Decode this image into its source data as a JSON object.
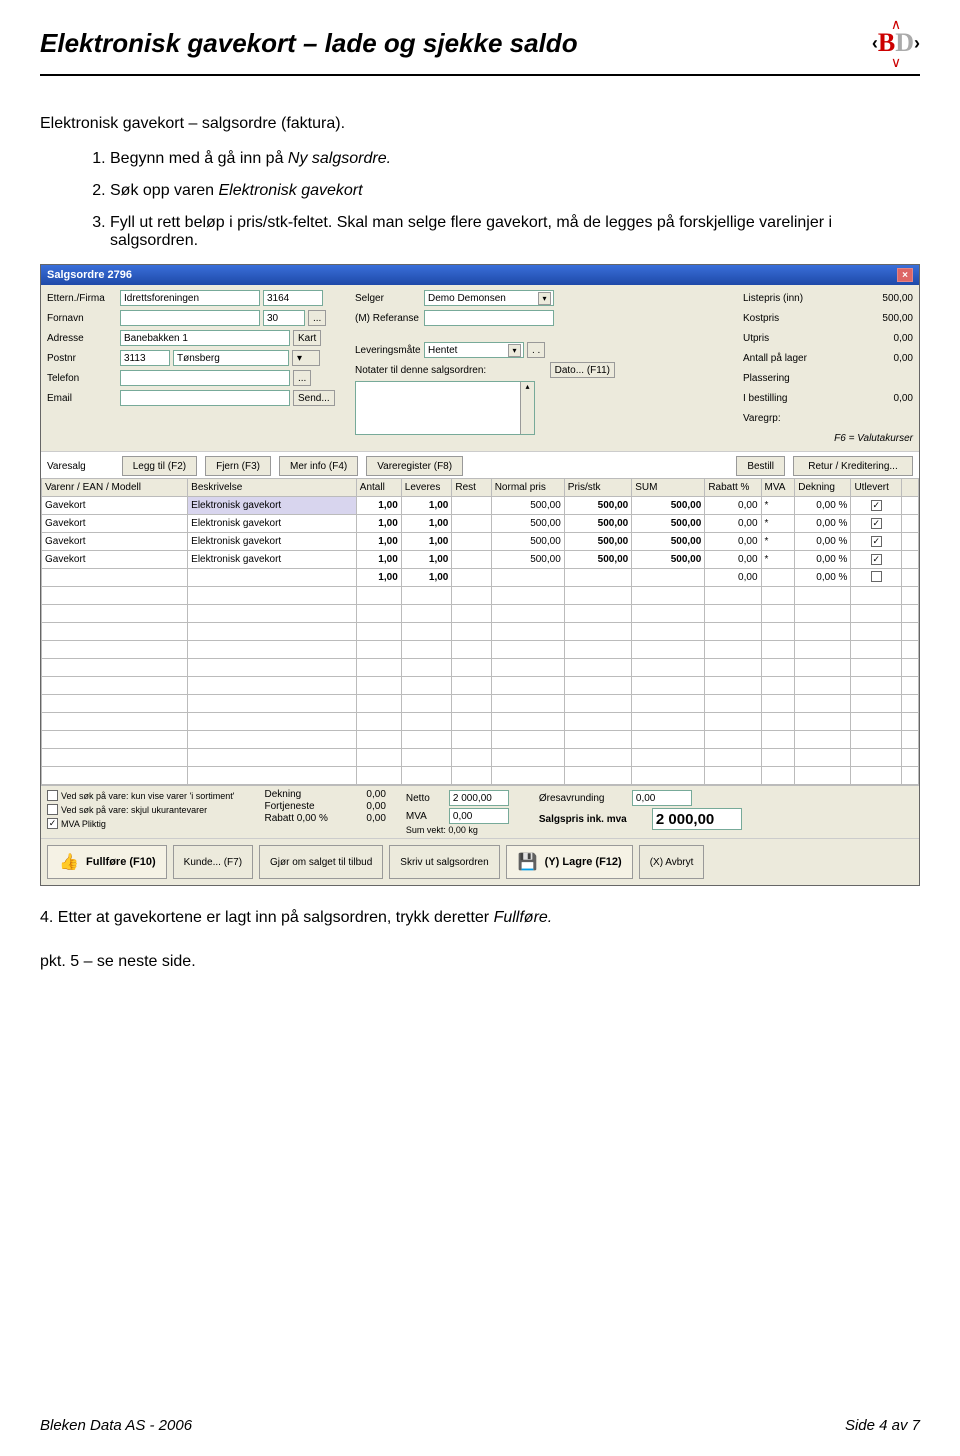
{
  "doc": {
    "title": "Elektronisk gavekort – lade og sjekke saldo",
    "section_heading": "Elektronisk gavekort – salgsordre (faktura).",
    "step1_a": "Begynn med å gå inn på ",
    "step1_em": "Ny salgsordre.",
    "step2_a": "Søk opp varen ",
    "step2_em": "Elektronisk gavekort",
    "step3": "Fyll ut rett beløp i pris/stk-feltet. Skal man selge flere gavekort, må de legges på forskjellige varelinjer i salgsordren.",
    "step4_a": "4. Etter at gavekortene er lagt inn på salgsordren, trykk deretter ",
    "step4_em": "Fullføre.",
    "pkt5": "pkt. 5 – se neste side.",
    "footer_left": "Bleken Data AS - 2006",
    "footer_right": "Side 4 av 7"
  },
  "win": {
    "title": "Salgsordre 2796",
    "cust": {
      "lbl_etternavn": "Ettern./Firma",
      "etternavn": "Idrettsforeningen",
      "kundeid": "3164",
      "lbl_fornavn": "Fornavn",
      "fornavn": "",
      "fornavn_nr": "30",
      "btn_dots": "...",
      "lbl_adresse": "Adresse",
      "adresse": "Banebakken 1",
      "btn_kart": "Kart",
      "lbl_postnr": "Postnr",
      "postnr": "3113",
      "poststed": "Tønsberg",
      "lbl_telefon": "Telefon",
      "telefon": "",
      "lbl_email": "Email",
      "email": "",
      "btn_send": "Send..."
    },
    "mid": {
      "lbl_selger": "Selger",
      "selger": "Demo Demonsen",
      "lbl_ref": "(M) Referanse",
      "lbl_lev": "Leveringsmåte",
      "lev": "Hentet",
      "btn_dotdot": ". .",
      "lbl_notater": "Notater til denne salgsordren:",
      "btn_dato": "Dato... (F11)"
    },
    "info": {
      "lbl_listepris": "Listepris (inn)",
      "listepris": "500,00",
      "lbl_kostpris": "Kostpris",
      "kostpris": "500,00",
      "lbl_utpris": "Utpris",
      "utpris": "0,00",
      "lbl_antall": "Antall på lager",
      "antall": "0,00",
      "lbl_plassering": "Plassering",
      "lbl_ibestilling": "I bestilling",
      "ibestilling": "0,00",
      "lbl_varegrp": "Varegrp:",
      "f6": "F6 = Valutakurser"
    },
    "toolbar": {
      "varesalg": "Varesalg",
      "leggtil": "Legg til (F2)",
      "fjern": "Fjern (F3)",
      "merinfo": "Mer info (F4)",
      "varereg": "Vareregister (F8)",
      "bestill": "Bestill",
      "retur": "Retur / Kreditering..."
    },
    "cols": {
      "varenr": "Varenr / EAN / Modell",
      "besk": "Beskrivelse",
      "antall": "Antall",
      "leveres": "Leveres",
      "rest": "Rest",
      "normal": "Normal pris",
      "prisstk": "Pris/stk",
      "sum": "SUM",
      "rabatt": "Rabatt %",
      "mva": "MVA",
      "dekning": "Dekning",
      "utlevert": "Utlevert"
    },
    "rows": [
      {
        "varenr": "Gavekort",
        "besk": "Elektronisk gavekort",
        "antall": "1,00",
        "lev": "1,00",
        "normal": "500,00",
        "pris": "500,00",
        "sum": "500,00",
        "rabatt": "0,00",
        "mva": "*",
        "dek": "0,00 %",
        "utl": "✓",
        "sel": true
      },
      {
        "varenr": "Gavekort",
        "besk": "Elektronisk gavekort",
        "antall": "1,00",
        "lev": "1,00",
        "normal": "500,00",
        "pris": "500,00",
        "sum": "500,00",
        "rabatt": "0,00",
        "mva": "*",
        "dek": "0,00 %",
        "utl": "✓"
      },
      {
        "varenr": "Gavekort",
        "besk": "Elektronisk gavekort",
        "antall": "1,00",
        "lev": "1,00",
        "normal": "500,00",
        "pris": "500,00",
        "sum": "500,00",
        "rabatt": "0,00",
        "mva": "*",
        "dek": "0,00 %",
        "utl": "✓"
      },
      {
        "varenr": "Gavekort",
        "besk": "Elektronisk gavekort",
        "antall": "1,00",
        "lev": "1,00",
        "normal": "500,00",
        "pris": "500,00",
        "sum": "500,00",
        "rabatt": "0,00",
        "mva": "*",
        "dek": "0,00 %",
        "utl": "✓"
      },
      {
        "varenr": "",
        "besk": "",
        "antall": "1,00",
        "lev": "1,00",
        "normal": "",
        "pris": "",
        "sum": "",
        "rabatt": "0,00",
        "mva": "",
        "dek": "0,00 %",
        "utl": ""
      }
    ],
    "foot": {
      "chk1": "Ved søk på vare: kun vise varer 'i sortiment'",
      "chk2": "Ved søk på vare: skjul ukurantevarer",
      "chk3": "MVA Pliktig",
      "lbl_dekning": "Dekning",
      "dekning": "0,00",
      "lbl_fortj": "Fortjeneste",
      "fortj": "0,00",
      "lbl_rabatt": "Rabatt  0,00 %",
      "rabatt": "0,00",
      "lbl_netto": "Netto",
      "netto": "2 000,00",
      "lbl_mva": "MVA",
      "mva": "0,00",
      "lbl_sumvekt": "Sum vekt: 0,00 kg",
      "lbl_ores": "Øresavrunding",
      "ores": "0,00",
      "lbl_salgspris": "Salgspris ink. mva",
      "salgspris": "2 000,00"
    },
    "buttons": {
      "fullfore": "Fullføre (F10)",
      "kunde": "Kunde... (F7)",
      "gjorom": "Gjør om salget til tilbud",
      "skriv": "Skriv ut salgsordren",
      "lagre": "(Y) Lagre (F12)",
      "avbryt": "(X) Avbryt"
    }
  }
}
